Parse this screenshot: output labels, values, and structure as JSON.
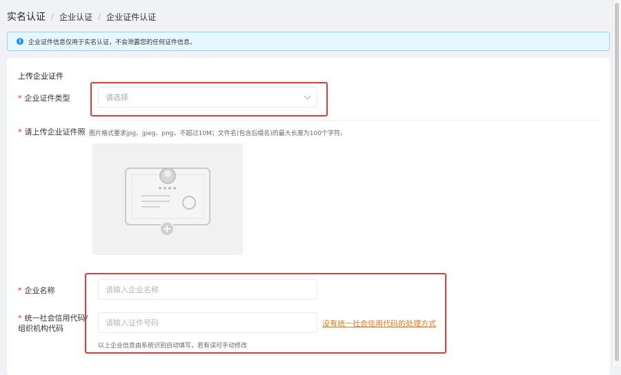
{
  "breadcrumb": {
    "root": "实名认证",
    "level2": "企业认证",
    "current": "企业证件认证",
    "separator": "/"
  },
  "alert": {
    "text": "企业证件信息仅用于实名认证，不会泄露您的任何证件信息。"
  },
  "section": {
    "title": "上传企业证件"
  },
  "required_mark": "*",
  "form": {
    "cert_type_label": "企业证件类型",
    "cert_type_placeholder": "请选择",
    "upload_label": "请上传企业证件照",
    "upload_hint": "图片格式要求jpg、jpeg、png，不超过10M；文件名(包含后缀名)的最大长度为100个字符。",
    "company_name_label": "企业名称",
    "company_name_placeholder": "请输入企业名称",
    "credit_code_label_line1": "统一社会信用代码/",
    "credit_code_label_line2": "组织机构代码",
    "credit_code_placeholder": "请输入证件号码",
    "no_code_link": "没有统一社会信用代码的处理方式",
    "autofill_hint": "以上企业信息由系统识别自动填写，若有误可手动修改"
  },
  "icons": {
    "info": "info-icon",
    "dropdown": "chevron-down-icon",
    "upload": "id-card-upload-icon",
    "add": "plus-icon"
  },
  "colors": {
    "accent_red": "#e53935",
    "link_orange": "#e8791a",
    "info_blue": "#1890ff",
    "alert_bg": "#e6f7ff"
  }
}
